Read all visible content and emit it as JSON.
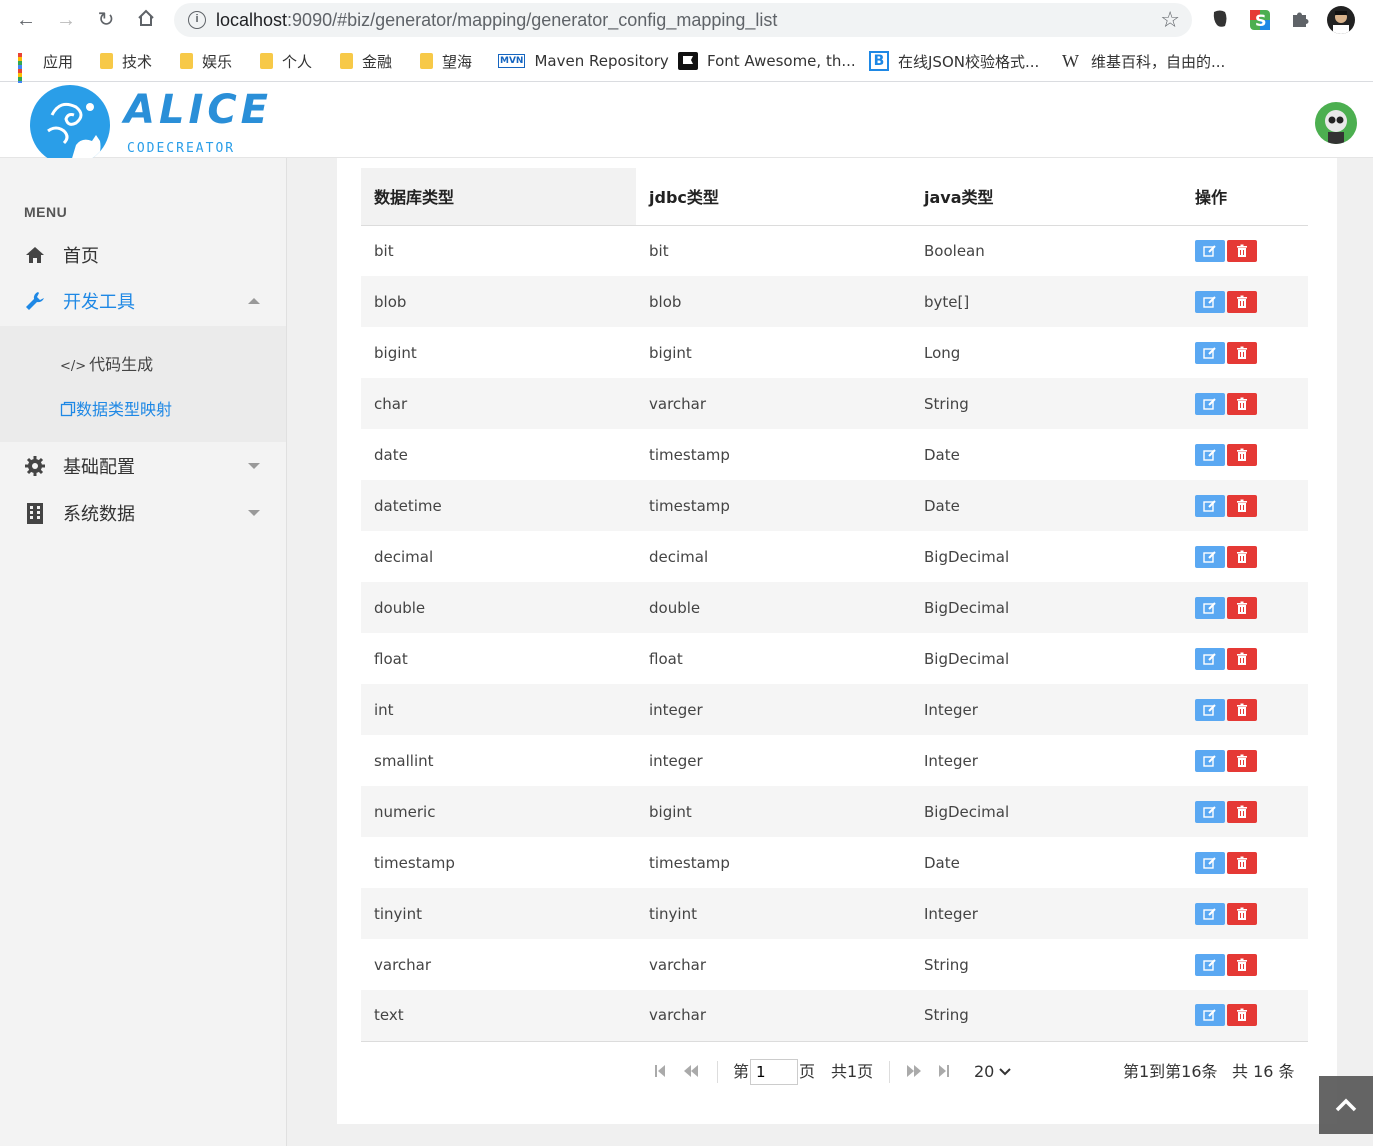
{
  "browser": {
    "url_host": "localhost",
    "url_rest": ":9090/#biz/generator/mapping/generator_config_mapping_list",
    "bookmarks": [
      {
        "label": "应用",
        "icon": "apps-icon"
      },
      {
        "label": "技术",
        "icon": "folder-icon"
      },
      {
        "label": "娱乐",
        "icon": "folder-icon"
      },
      {
        "label": "个人",
        "icon": "folder-icon"
      },
      {
        "label": "金融",
        "icon": "folder-icon"
      },
      {
        "label": "望海",
        "icon": "folder-icon"
      },
      {
        "label": "Maven Repository",
        "icon": "mvn-icon"
      },
      {
        "label": "Font Awesome, th...",
        "icon": "flag-icon"
      },
      {
        "label": "在线JSON校验格式...",
        "icon": "bejson-icon"
      },
      {
        "label": "维基百科，自由的...",
        "icon": "wikipedia-icon"
      }
    ]
  },
  "header": {
    "logo_title": "ALICE",
    "logo_subtitle": "CODECREATOR"
  },
  "sidebar": {
    "menu_title": "MENU",
    "items": [
      {
        "label": "首页",
        "icon": "home-icon"
      },
      {
        "label": "开发工具",
        "icon": "wrench-icon"
      },
      {
        "label": "基础配置",
        "icon": "gear-icon"
      },
      {
        "label": "系统数据",
        "icon": "building-icon"
      }
    ],
    "sub_items": [
      {
        "label": "代码生成",
        "icon": "code-icon"
      },
      {
        "label": "数据类型映射",
        "icon": "copy-icon"
      }
    ]
  },
  "table": {
    "headers": [
      "数据库类型",
      "jdbc类型",
      "java类型",
      "操作"
    ],
    "rows": [
      [
        "bit",
        "bit",
        "Boolean"
      ],
      [
        "blob",
        "blob",
        "byte[]"
      ],
      [
        "bigint",
        "bigint",
        "Long"
      ],
      [
        "char",
        "varchar",
        "String"
      ],
      [
        "date",
        "timestamp",
        "Date"
      ],
      [
        "datetime",
        "timestamp",
        "Date"
      ],
      [
        "decimal",
        "decimal",
        "BigDecimal"
      ],
      [
        "double",
        "double",
        "BigDecimal"
      ],
      [
        "float",
        "float",
        "BigDecimal"
      ],
      [
        "int",
        "integer",
        "Integer"
      ],
      [
        "smallint",
        "integer",
        "Integer"
      ],
      [
        "numeric",
        "bigint",
        "BigDecimal"
      ],
      [
        "timestamp",
        "timestamp",
        "Date"
      ],
      [
        "tinyint",
        "tinyint",
        "Integer"
      ],
      [
        "varchar",
        "varchar",
        "String"
      ],
      [
        "text",
        "varchar",
        "String"
      ]
    ]
  },
  "pagination": {
    "page_prefix": "第",
    "page_value": "1",
    "page_suffix": "页",
    "total_pages": "共1页",
    "page_size": "20",
    "range_text": "第1到第16条",
    "total_text": "共 16 条"
  },
  "colors": {
    "accent": "#1e88e5",
    "edit_button": "#5aa8f2",
    "delete_button": "#e53935"
  }
}
